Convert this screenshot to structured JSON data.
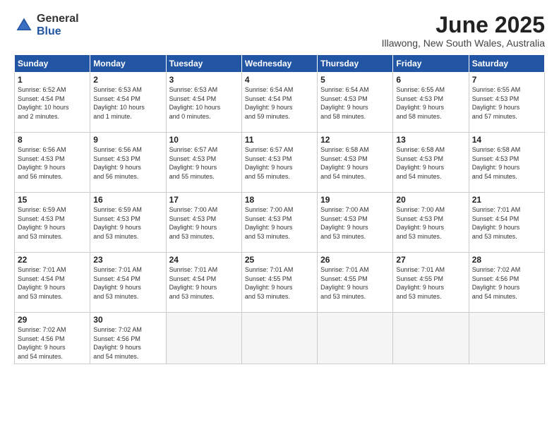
{
  "logo": {
    "general": "General",
    "blue": "Blue"
  },
  "title": "June 2025",
  "subtitle": "Illawong, New South Wales, Australia",
  "days_of_week": [
    "Sunday",
    "Monday",
    "Tuesday",
    "Wednesday",
    "Thursday",
    "Friday",
    "Saturday"
  ],
  "weeks": [
    [
      {
        "day": "1",
        "info": "Sunrise: 6:52 AM\nSunset: 4:54 PM\nDaylight: 10 hours\nand 2 minutes."
      },
      {
        "day": "2",
        "info": "Sunrise: 6:53 AM\nSunset: 4:54 PM\nDaylight: 10 hours\nand 1 minute."
      },
      {
        "day": "3",
        "info": "Sunrise: 6:53 AM\nSunset: 4:54 PM\nDaylight: 10 hours\nand 0 minutes."
      },
      {
        "day": "4",
        "info": "Sunrise: 6:54 AM\nSunset: 4:54 PM\nDaylight: 9 hours\nand 59 minutes."
      },
      {
        "day": "5",
        "info": "Sunrise: 6:54 AM\nSunset: 4:53 PM\nDaylight: 9 hours\nand 58 minutes."
      },
      {
        "day": "6",
        "info": "Sunrise: 6:55 AM\nSunset: 4:53 PM\nDaylight: 9 hours\nand 58 minutes."
      },
      {
        "day": "7",
        "info": "Sunrise: 6:55 AM\nSunset: 4:53 PM\nDaylight: 9 hours\nand 57 minutes."
      }
    ],
    [
      {
        "day": "8",
        "info": "Sunrise: 6:56 AM\nSunset: 4:53 PM\nDaylight: 9 hours\nand 56 minutes."
      },
      {
        "day": "9",
        "info": "Sunrise: 6:56 AM\nSunset: 4:53 PM\nDaylight: 9 hours\nand 56 minutes."
      },
      {
        "day": "10",
        "info": "Sunrise: 6:57 AM\nSunset: 4:53 PM\nDaylight: 9 hours\nand 55 minutes."
      },
      {
        "day": "11",
        "info": "Sunrise: 6:57 AM\nSunset: 4:53 PM\nDaylight: 9 hours\nand 55 minutes."
      },
      {
        "day": "12",
        "info": "Sunrise: 6:58 AM\nSunset: 4:53 PM\nDaylight: 9 hours\nand 54 minutes."
      },
      {
        "day": "13",
        "info": "Sunrise: 6:58 AM\nSunset: 4:53 PM\nDaylight: 9 hours\nand 54 minutes."
      },
      {
        "day": "14",
        "info": "Sunrise: 6:58 AM\nSunset: 4:53 PM\nDaylight: 9 hours\nand 54 minutes."
      }
    ],
    [
      {
        "day": "15",
        "info": "Sunrise: 6:59 AM\nSunset: 4:53 PM\nDaylight: 9 hours\nand 53 minutes."
      },
      {
        "day": "16",
        "info": "Sunrise: 6:59 AM\nSunset: 4:53 PM\nDaylight: 9 hours\nand 53 minutes."
      },
      {
        "day": "17",
        "info": "Sunrise: 7:00 AM\nSunset: 4:53 PM\nDaylight: 9 hours\nand 53 minutes."
      },
      {
        "day": "18",
        "info": "Sunrise: 7:00 AM\nSunset: 4:53 PM\nDaylight: 9 hours\nand 53 minutes."
      },
      {
        "day": "19",
        "info": "Sunrise: 7:00 AM\nSunset: 4:53 PM\nDaylight: 9 hours\nand 53 minutes."
      },
      {
        "day": "20",
        "info": "Sunrise: 7:00 AM\nSunset: 4:53 PM\nDaylight: 9 hours\nand 53 minutes."
      },
      {
        "day": "21",
        "info": "Sunrise: 7:01 AM\nSunset: 4:54 PM\nDaylight: 9 hours\nand 53 minutes."
      }
    ],
    [
      {
        "day": "22",
        "info": "Sunrise: 7:01 AM\nSunset: 4:54 PM\nDaylight: 9 hours\nand 53 minutes."
      },
      {
        "day": "23",
        "info": "Sunrise: 7:01 AM\nSunset: 4:54 PM\nDaylight: 9 hours\nand 53 minutes."
      },
      {
        "day": "24",
        "info": "Sunrise: 7:01 AM\nSunset: 4:54 PM\nDaylight: 9 hours\nand 53 minutes."
      },
      {
        "day": "25",
        "info": "Sunrise: 7:01 AM\nSunset: 4:55 PM\nDaylight: 9 hours\nand 53 minutes."
      },
      {
        "day": "26",
        "info": "Sunrise: 7:01 AM\nSunset: 4:55 PM\nDaylight: 9 hours\nand 53 minutes."
      },
      {
        "day": "27",
        "info": "Sunrise: 7:01 AM\nSunset: 4:55 PM\nDaylight: 9 hours\nand 53 minutes."
      },
      {
        "day": "28",
        "info": "Sunrise: 7:02 AM\nSunset: 4:56 PM\nDaylight: 9 hours\nand 54 minutes."
      }
    ],
    [
      {
        "day": "29",
        "info": "Sunrise: 7:02 AM\nSunset: 4:56 PM\nDaylight: 9 hours\nand 54 minutes."
      },
      {
        "day": "30",
        "info": "Sunrise: 7:02 AM\nSunset: 4:56 PM\nDaylight: 9 hours\nand 54 minutes."
      },
      {
        "day": "",
        "info": ""
      },
      {
        "day": "",
        "info": ""
      },
      {
        "day": "",
        "info": ""
      },
      {
        "day": "",
        "info": ""
      },
      {
        "day": "",
        "info": ""
      }
    ]
  ]
}
